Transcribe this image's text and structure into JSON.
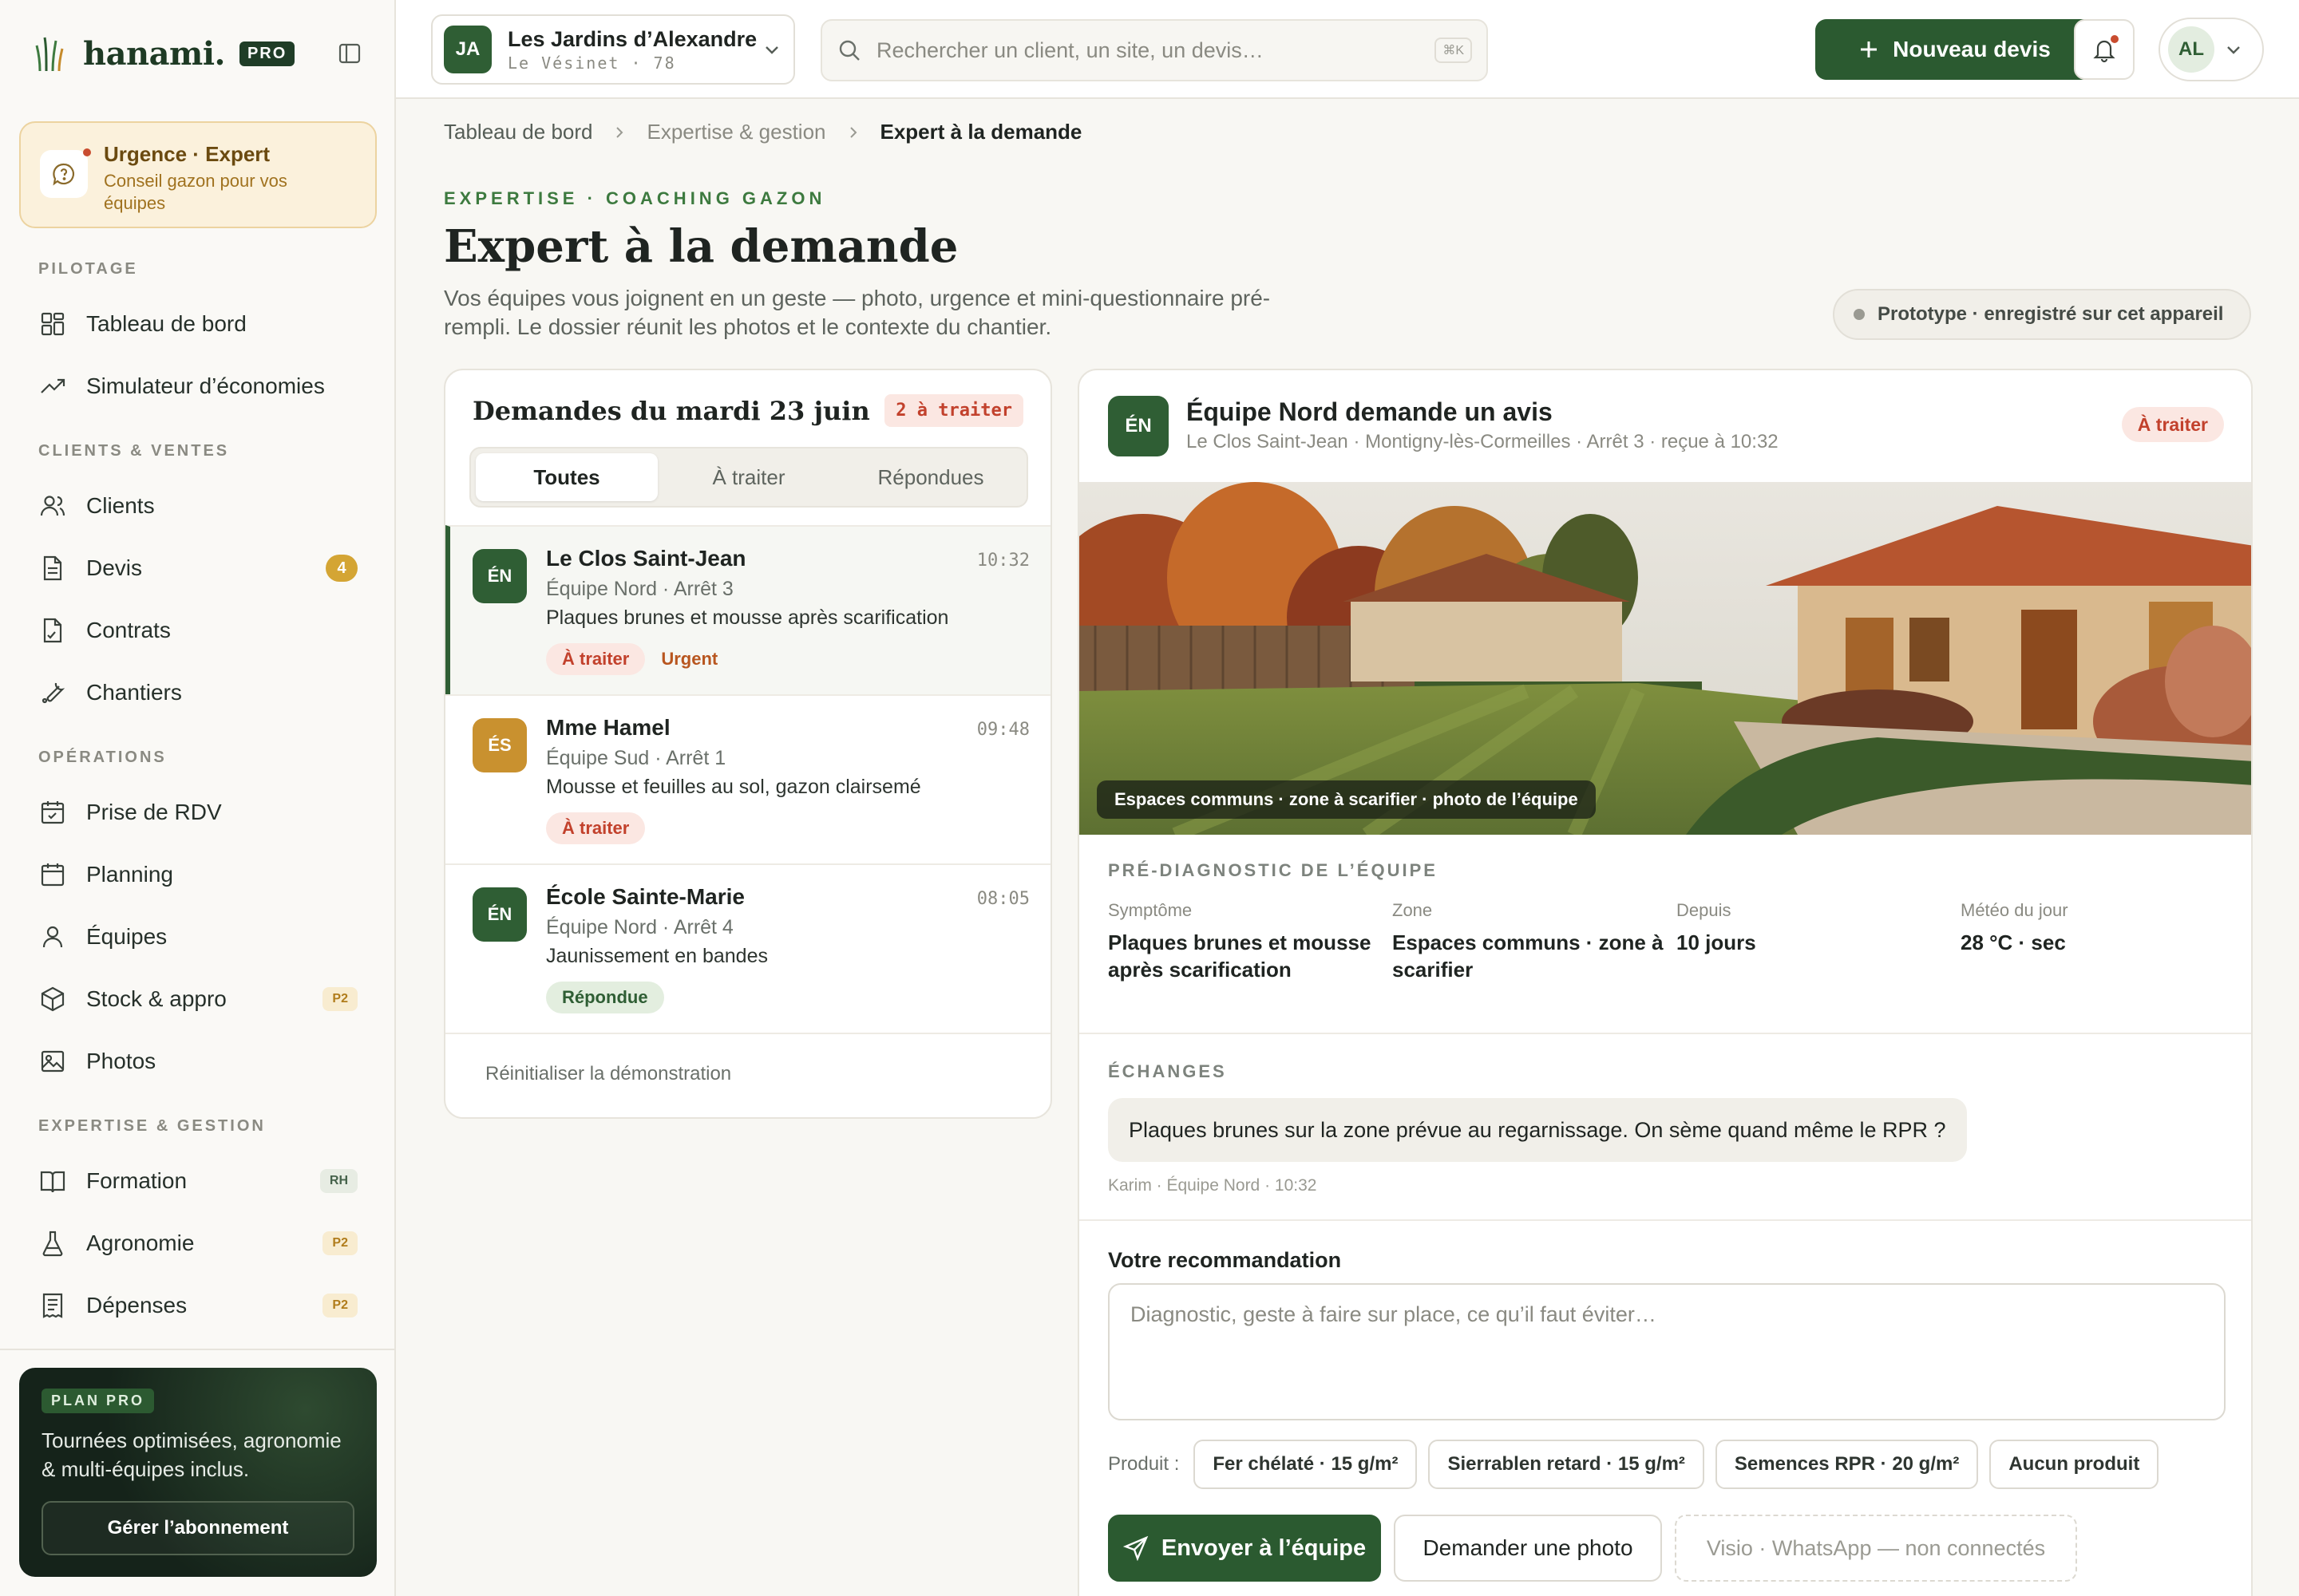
{
  "brand": {
    "name": "hanami.",
    "badge": "PRO"
  },
  "urgent": {
    "title": "Urgence · Expert",
    "subtitle": "Conseil gazon pour vos équipes"
  },
  "nav": {
    "pilotage": {
      "label": "PILOTAGE",
      "items": [
        "Tableau de bord",
        "Simulateur d’économies"
      ]
    },
    "clients": {
      "label": "CLIENTS & VENTES",
      "items": [
        "Clients",
        "Devis",
        "Contrats",
        "Chantiers"
      ],
      "devis_badge": "4"
    },
    "ops": {
      "label": "OPÉRATIONS",
      "items": [
        "Prise de RDV",
        "Planning",
        "Équipes",
        "Stock & appro",
        "Photos"
      ],
      "stock_tag": "P2"
    },
    "expertise": {
      "label": "EXPERTISE & GESTION",
      "items": [
        "Formation",
        "Agronomie",
        "Dépenses"
      ],
      "tags": [
        "RH",
        "P2",
        "P2"
      ]
    }
  },
  "plan": {
    "label": "PLAN PRO",
    "text": "Tournées optimisées, agronomie & multi-équipes inclus.",
    "button": "Gérer l’abonnement"
  },
  "topbar": {
    "workspace": {
      "initials": "JA",
      "name": "Les Jardins d’Alexandre",
      "sub": "Le Vésinet · 78"
    },
    "search_placeholder": "Rechercher un client, un site, un devis…",
    "shortcut": "⌘K",
    "new_button": "Nouveau devis",
    "user_initials": "AL"
  },
  "breadcrumb": [
    "Tableau de bord",
    "Expertise & gestion",
    "Expert à la demande"
  ],
  "header": {
    "eyebrow": "EXPERTISE · COACHING GAZON",
    "title": "Expert à la demande",
    "subtitle": "Vos équipes vous joignent en un geste — photo, urgence et mini-questionnaire pré-rempli. Le dossier réunit les photos et le contexte du chantier.",
    "prototype_chip": "Prototype · enregistré sur cet appareil"
  },
  "requests": {
    "title": "Demandes du mardi 23 juin",
    "count": "2 à traiter",
    "tabs": [
      "Toutes",
      "À traiter",
      "Répondues"
    ],
    "items": [
      {
        "initials": "ÉN",
        "name": "Le Clos Saint-Jean",
        "time": "10:32",
        "team": "Équipe Nord · Arrêt 3",
        "desc": "Plaques brunes et mousse après scarification",
        "status": "À traiter",
        "urgent": "Urgent"
      },
      {
        "initials": "ÉS",
        "name": "Mme Hamel",
        "time": "09:48",
        "team": "Équipe Sud · Arrêt 1",
        "desc": "Mousse et feuilles au sol, gazon clairsemé",
        "status": "À traiter"
      },
      {
        "initials": "ÉN",
        "name": "École Sainte-Marie",
        "time": "08:05",
        "team": "Équipe Nord · Arrêt 4",
        "desc": "Jaunissement en bandes",
        "status": "Répondue"
      }
    ],
    "reset": "Réinitialiser la démonstration"
  },
  "detail": {
    "initials": "ÉN",
    "title": "Équipe Nord demande un avis",
    "meta": "Le Clos Saint-Jean · Montigny-lès-Cormeilles · Arrêt 3 · reçue à 10:32",
    "status": "À traiter",
    "photo_caption": "Espaces communs · zone à scarifier · photo de l’équipe",
    "diag_label": "PRÉ-DIAGNOSTIC DE L’ÉQUIPE",
    "diag": [
      {
        "k": "Symptôme",
        "v": "Plaques brunes et mousse après scarification"
      },
      {
        "k": "Zone",
        "v": "Espaces communs · zone à scarifier"
      },
      {
        "k": "Depuis",
        "v": "10 jours"
      },
      {
        "k": "Météo du jour",
        "v": "28 °C · sec"
      }
    ],
    "exchanges_label": "ÉCHANGES",
    "message": "Plaques brunes sur la zone prévue au regarnissage. On sème quand même le RPR ?",
    "message_meta": "Karim · Équipe Nord · 10:32",
    "rec_label": "Votre recommandation",
    "rec_placeholder": "Diagnostic, geste à faire sur place, ce qu’il faut éviter…",
    "product_label": "Produit :",
    "products": [
      "Fer chélaté · 15 g/m²",
      "Sierrablen retard · 15 g/m²",
      "Semences RPR · 20 g/m²",
      "Aucun produit"
    ],
    "send": "Envoyer à l’équipe",
    "ask_photo": "Demander une photo",
    "visio": "Visio · WhatsApp — non connectés"
  },
  "colors": {
    "brand_green": "#2b5a30",
    "urgent_red": "#c2412c",
    "badge_gold": "#d4a534"
  }
}
